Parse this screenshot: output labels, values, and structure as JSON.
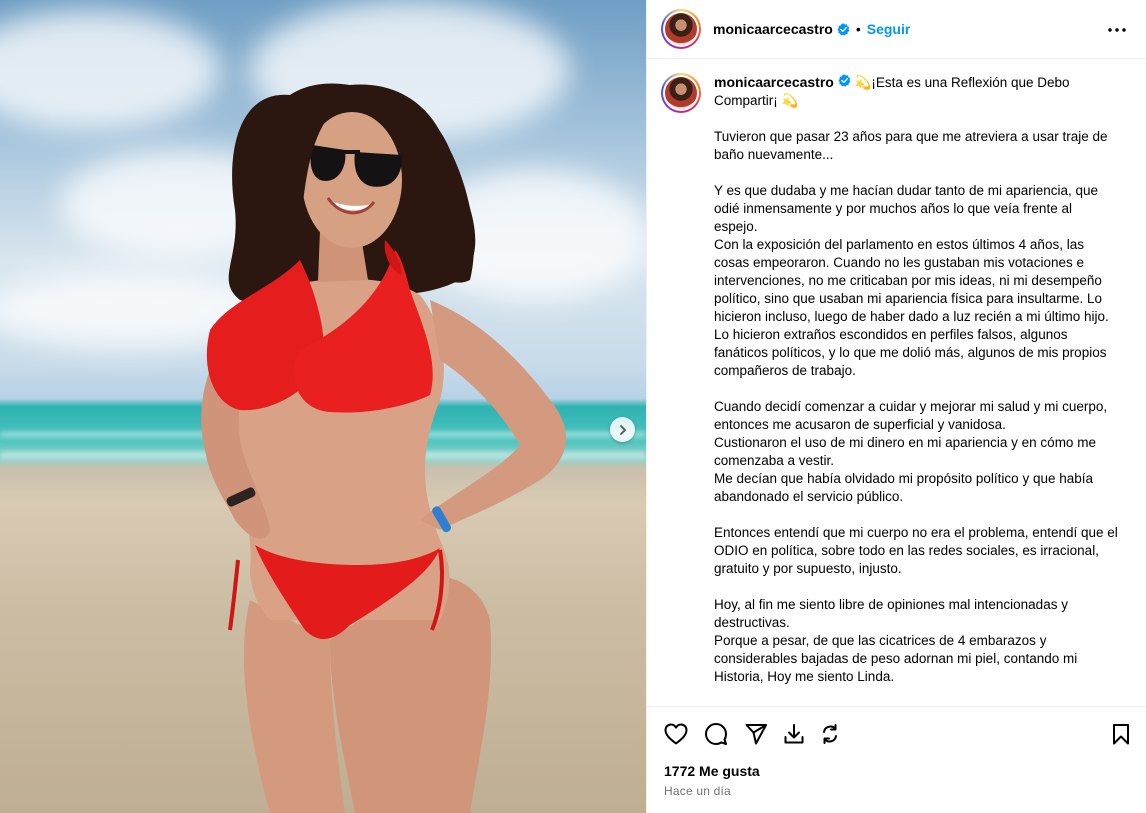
{
  "post": {
    "image_alt": "Mujer en traje de baño rojo en la playa",
    "has_next_image": true
  },
  "header": {
    "username": "monicaarcecastro",
    "verified": true,
    "separator": "•",
    "follow_label": "Seguir",
    "more_icon": "more-horizontal-icon"
  },
  "caption": {
    "username": "monicaarcecastro",
    "text": " 💫¡Esta es una Reflexión que Debo Compartir¡ 💫\n\nTuvieron que pasar 23 años para que me atreviera a usar traje de baño nuevamente...\n\nY es que dudaba y me hacían dudar tanto de mi apariencia, que odié inmensamente y por muchos años lo que veía frente al espejo.\nCon la exposición del parlamento en estos últimos 4 años, las cosas empeoraron. Cuando no les gustaban mis votaciones e intervenciones, no me criticaban por mis ideas, ni mi desempeño político, sino que usaban mi apariencia física para insultarme. Lo hicieron incluso, luego de haber dado a luz recién a mi último hijo.\nLo hicieron extraños escondidos en perfiles falsos, algunos fanáticos políticos, y lo que me dolió más, algunos de mis propios compañeros de trabajo.\n\nCuando decidí comenzar a cuidar y mejorar mi salud y mi cuerpo, entonces me acusaron de superficial y vanidosa.\nCustionaron el uso de mi dinero en mi apariencia y en cómo me comenzaba a vestir.\nMe decían que había olvidado mi propósito político y que había abandonado el servicio público.\n\nEntonces entendí que mi cuerpo no era el problema, entendí que el ODIO en política, sobre todo en las redes sociales, es irracional, gratuito y por supuesto, injusto.\n\nHoy, al fin me siento libre de opiniones mal intencionadas y destructivas.\nPorque a pesar, de que las cicatrices de 4 embarazos y considerables bajadas de peso adornan mi piel, contando mi Historia, Hoy me siento Linda."
  },
  "actions": {
    "like_icon": "heart-icon",
    "comment_icon": "comment-icon",
    "share_icon": "send-icon",
    "download_icon": "download-icon",
    "repost_icon": "repost-icon",
    "save_icon": "bookmark-icon"
  },
  "likes_text": "1772 Me gusta",
  "time_text": "Hace un día",
  "colors": {
    "follow_blue": "#0095f6",
    "verified_blue": "#0095f6",
    "secondary_text": "#737373",
    "divider": "#efefef"
  }
}
